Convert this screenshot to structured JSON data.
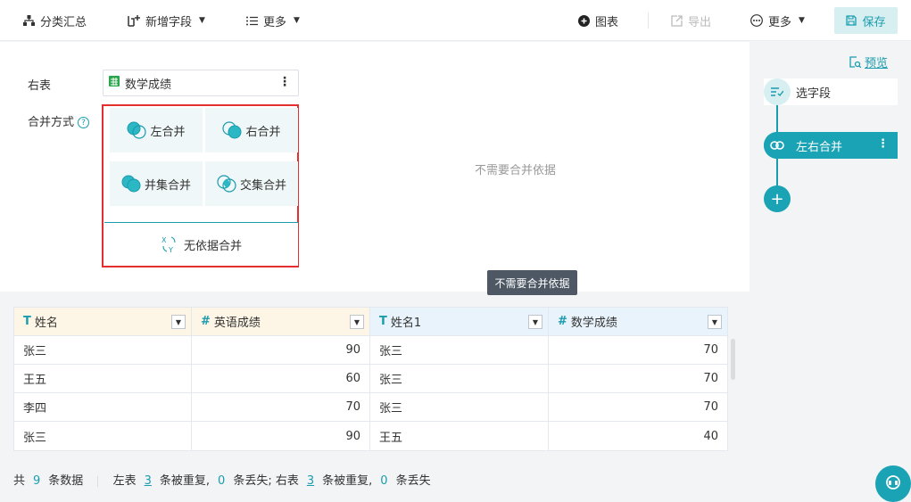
{
  "toolbar": {
    "group_summary": "分类汇总",
    "add_field": "新增字段",
    "more_left": "更多",
    "chart": "图表",
    "export": "导出",
    "more_right": "更多",
    "save": "保存"
  },
  "config": {
    "right_table_label": "右表",
    "right_table_name": "数学成绩",
    "merge_method_label": "合并方式",
    "help_glyph": "?",
    "options": {
      "left": "左合并",
      "right": "右合并",
      "union": "并集合并",
      "intersect": "交集合并",
      "none": "无依据合并"
    },
    "no_basis_text": "不需要合并依据"
  },
  "tooltip": "不需要合并依据",
  "table": {
    "headers": [
      {
        "type_glyph": "T",
        "label": "姓名"
      },
      {
        "type_glyph": "#",
        "label": "英语成绩"
      },
      {
        "type_glyph": "T",
        "label": "姓名1"
      },
      {
        "type_glyph": "#",
        "label": "数学成绩"
      }
    ],
    "rows": [
      [
        "张三",
        "90",
        "张三",
        "70"
      ],
      [
        "王五",
        "60",
        "张三",
        "70"
      ],
      [
        "李四",
        "70",
        "张三",
        "70"
      ],
      [
        "张三",
        "90",
        "王五",
        "40"
      ]
    ]
  },
  "footer": {
    "total_prefix": "共",
    "total_count": "9",
    "total_suffix": "条数据",
    "left_label": "左表",
    "left_dup": "3",
    "dup_text": "条被重复,",
    "left_lost": "0",
    "lost_text_semicolon": "条丢失;",
    "right_label": "右表",
    "right_dup": "3",
    "dup_text2": "条被重复,",
    "right_lost": "0",
    "lost_text": "条丢失"
  },
  "flow": {
    "preview": "预览",
    "node_select": "选字段",
    "node_merge": "左右合并",
    "add": "+"
  },
  "colors": {
    "accent": "#1aa3b5",
    "highlight_border": "#e3302f",
    "left_header_bg": "#fdf6e6",
    "right_header_bg": "#e8f3fb"
  }
}
